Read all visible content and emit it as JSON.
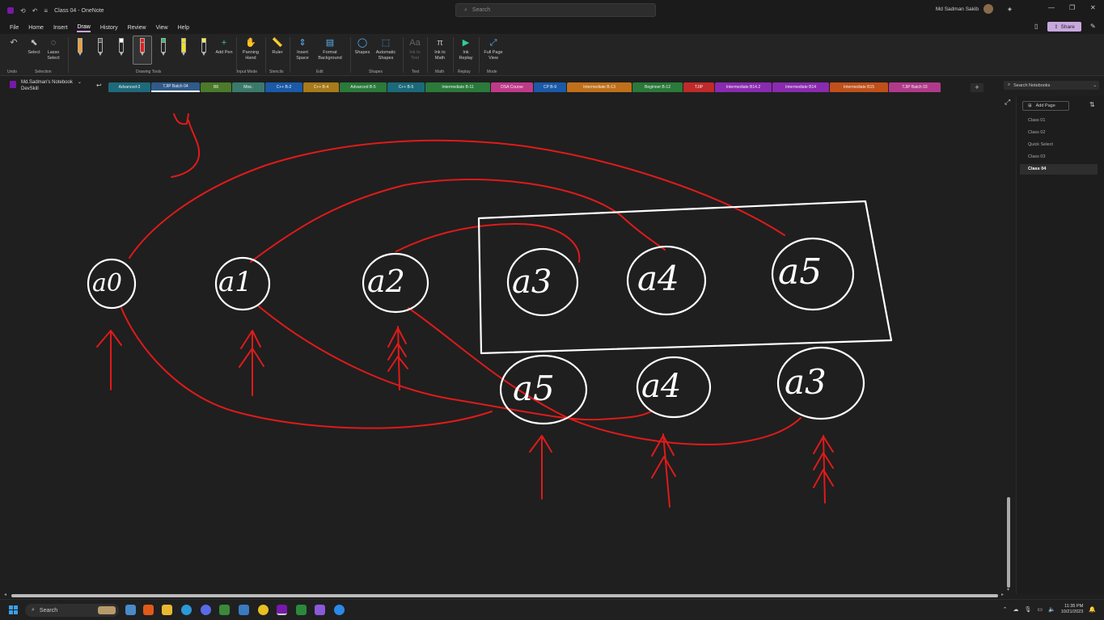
{
  "window": {
    "title": "Class 04 - OneNote",
    "search_placeholder": "Search",
    "user_name": "Md Sadman Sakib"
  },
  "menu": {
    "items": [
      "File",
      "Home",
      "Insert",
      "Draw",
      "History",
      "Review",
      "View",
      "Help"
    ],
    "active": "Draw",
    "share_label": "Share"
  },
  "ribbon": {
    "undo": "Undo",
    "select": "Select",
    "lasso_select": "Lasso Select",
    "add_pen": "Add Pen",
    "panning_hand": "Panning Hand",
    "ruler": "Ruler",
    "insert_space": "Insert Space",
    "format_background": "Format Background",
    "shapes": "Shapes",
    "automatic_shapes": "Automatic Shapes",
    "ink_to_text": "Ink to Text",
    "ink_to_math": "Ink to Math",
    "ink_replay": "Ink Replay",
    "full_page_view": "Full Page View",
    "groups": {
      "undo": "Undo",
      "selection": "Selection",
      "drawing_tools": "Drawing Tools",
      "input_mode": "Input Mode",
      "stencils": "Stencils",
      "edit": "Edit",
      "shapes": "Shapes",
      "text": "Text",
      "math": "Math",
      "replay": "Replay",
      "mode": "Mode"
    },
    "pen_colors": [
      "#f0a030",
      "#dddddd",
      "#ffffff",
      "#e02020",
      "#30c060",
      "#f0e020",
      "#f0f040"
    ]
  },
  "notebook": {
    "name": "Md.Sadman's Notebook",
    "subtitle": "DevSkill",
    "search_placeholder": "Search Notebooks",
    "sections": [
      {
        "label": "Advanced-3",
        "color": "#1e6a7a"
      },
      {
        "label": "TJIP Batch 04",
        "color": "#2f5a8a"
      },
      {
        "label": "B8",
        "color": "#4a7a2a"
      },
      {
        "label": "Misc.",
        "color": "#3a7a6a"
      },
      {
        "label": "C++ B-2",
        "color": "#1a5aa8"
      },
      {
        "label": "C++ B-4",
        "color": "#a87a1a"
      },
      {
        "label": "Advanced B-5",
        "color": "#2a7a3a"
      },
      {
        "label": "C++ B-5",
        "color": "#1a6a7a"
      },
      {
        "label": "Intermediate B-11",
        "color": "#2a7a3a"
      },
      {
        "label": "DSA Course",
        "color": "#c03a8a"
      },
      {
        "label": "CP B-9",
        "color": "#1a5aa8"
      },
      {
        "label": "Intermediate B-13",
        "color": "#c0701a"
      },
      {
        "label": "Beginner B-12",
        "color": "#2a7a3a"
      },
      {
        "label": "TJIP",
        "color": "#c02a2a"
      },
      {
        "label": "Intermediate B14.2",
        "color": "#8a2ab0"
      },
      {
        "label": "Intermediate B14",
        "color": "#8a2ab0"
      },
      {
        "label": "Intermediate B15",
        "color": "#c0501a"
      },
      {
        "label": "TJIP Batch 03",
        "color": "#b03a8a"
      }
    ],
    "active_section": "TJIP Batch 04"
  },
  "pages": {
    "add_label": "Add Page",
    "items": [
      "Class 01",
      "Class 02",
      "Quick Select",
      "Class 03",
      "Class 04"
    ],
    "selected": "Class 04"
  },
  "drawing": {
    "top_row_labels": [
      "a0",
      "a1",
      "a2",
      "a3",
      "a4",
      "a5"
    ],
    "bottom_row_labels": [
      "a5",
      "a4",
      "a3"
    ],
    "top_row_arrow_counts": [
      1,
      2,
      3
    ],
    "bottom_row_arrow_counts": [
      1,
      2,
      3
    ],
    "ink_white": "#ffffff",
    "ink_red": "#e01a1a"
  },
  "taskbar": {
    "search_label": "Search",
    "time": "11:35 PM",
    "date": "10/21/2023"
  }
}
